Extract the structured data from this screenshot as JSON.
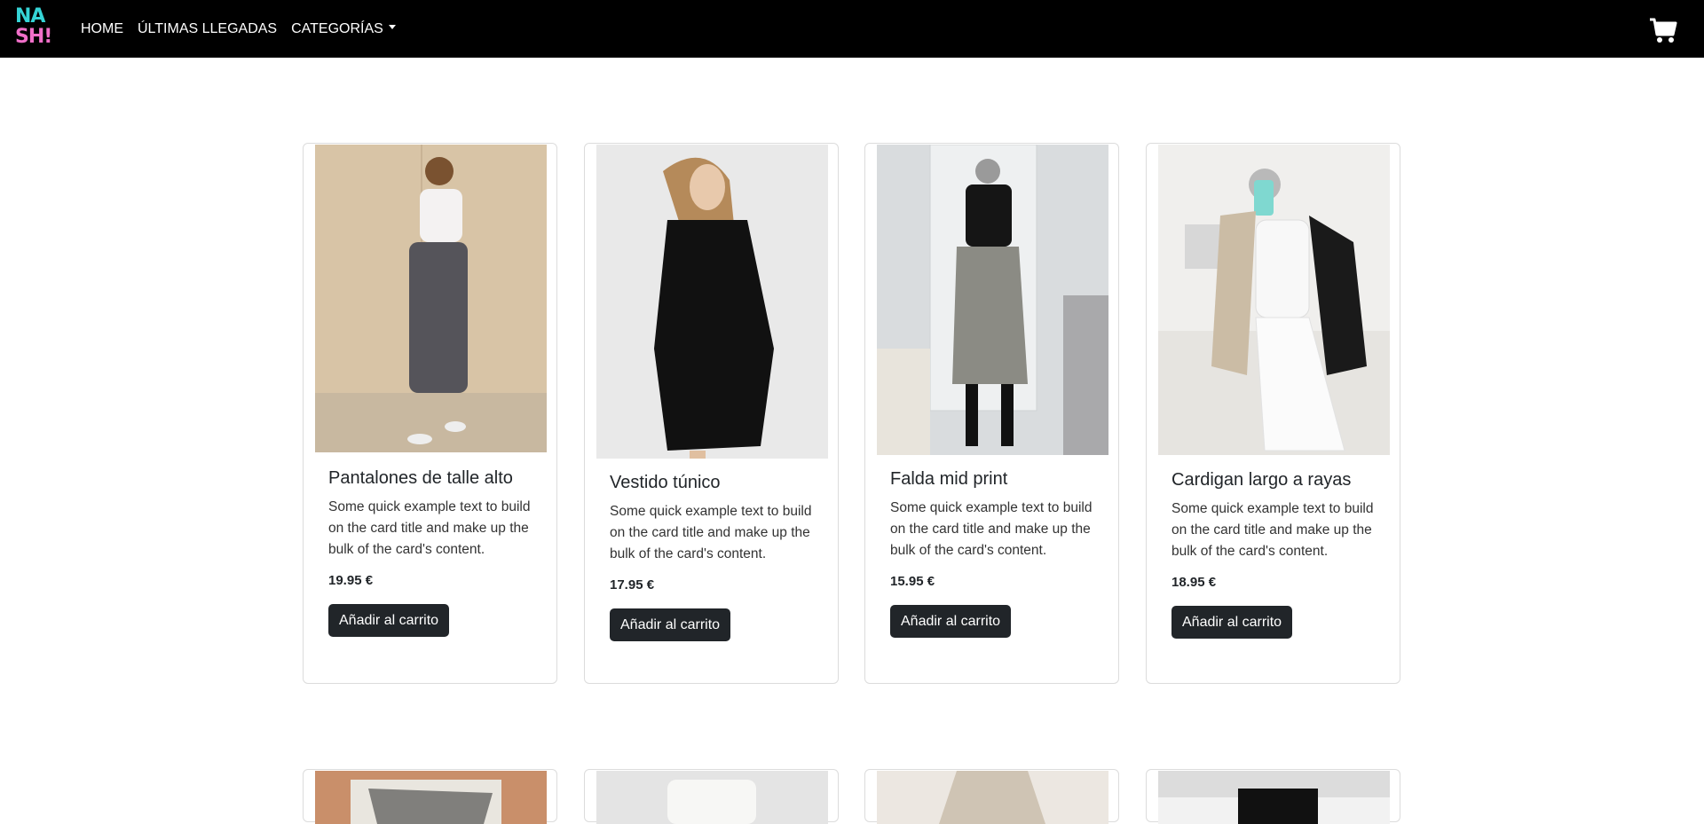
{
  "navbar": {
    "logo_line1": "NA",
    "logo_line2": "SH!",
    "links": [
      "HOME",
      "ÚLTIMAS LLEGADAS",
      "CATEGORÍAS"
    ],
    "cart_icon": "shopping-cart-icon"
  },
  "colors": {
    "navbar_bg": "#000000",
    "button_bg": "#212529",
    "logo_cyan": "#35d4d6",
    "logo_pink": "#f06fc8"
  },
  "products": [
    {
      "title": "Pantalones de talle alto",
      "text": "Some quick example text to build on the card title and make up the bulk of the card's content.",
      "price": "19.95 €",
      "button": "Añadir al carrito"
    },
    {
      "title": "Vestido túnico",
      "text": "Some quick example text to build on the card title and make up the bulk of the card's content.",
      "price": "17.95 €",
      "button": "Añadir al carrito"
    },
    {
      "title": "Falda mid print",
      "text": "Some quick example text to build on the card title and make up the bulk of the card's content.",
      "price": "15.95 €",
      "button": "Añadir al carrito"
    },
    {
      "title": "Cardigan largo a rayas",
      "text": "Some quick example text to build on the card title and make up the bulk of the card's content.",
      "price": "18.95 €",
      "button": "Añadir al carrito"
    }
  ]
}
